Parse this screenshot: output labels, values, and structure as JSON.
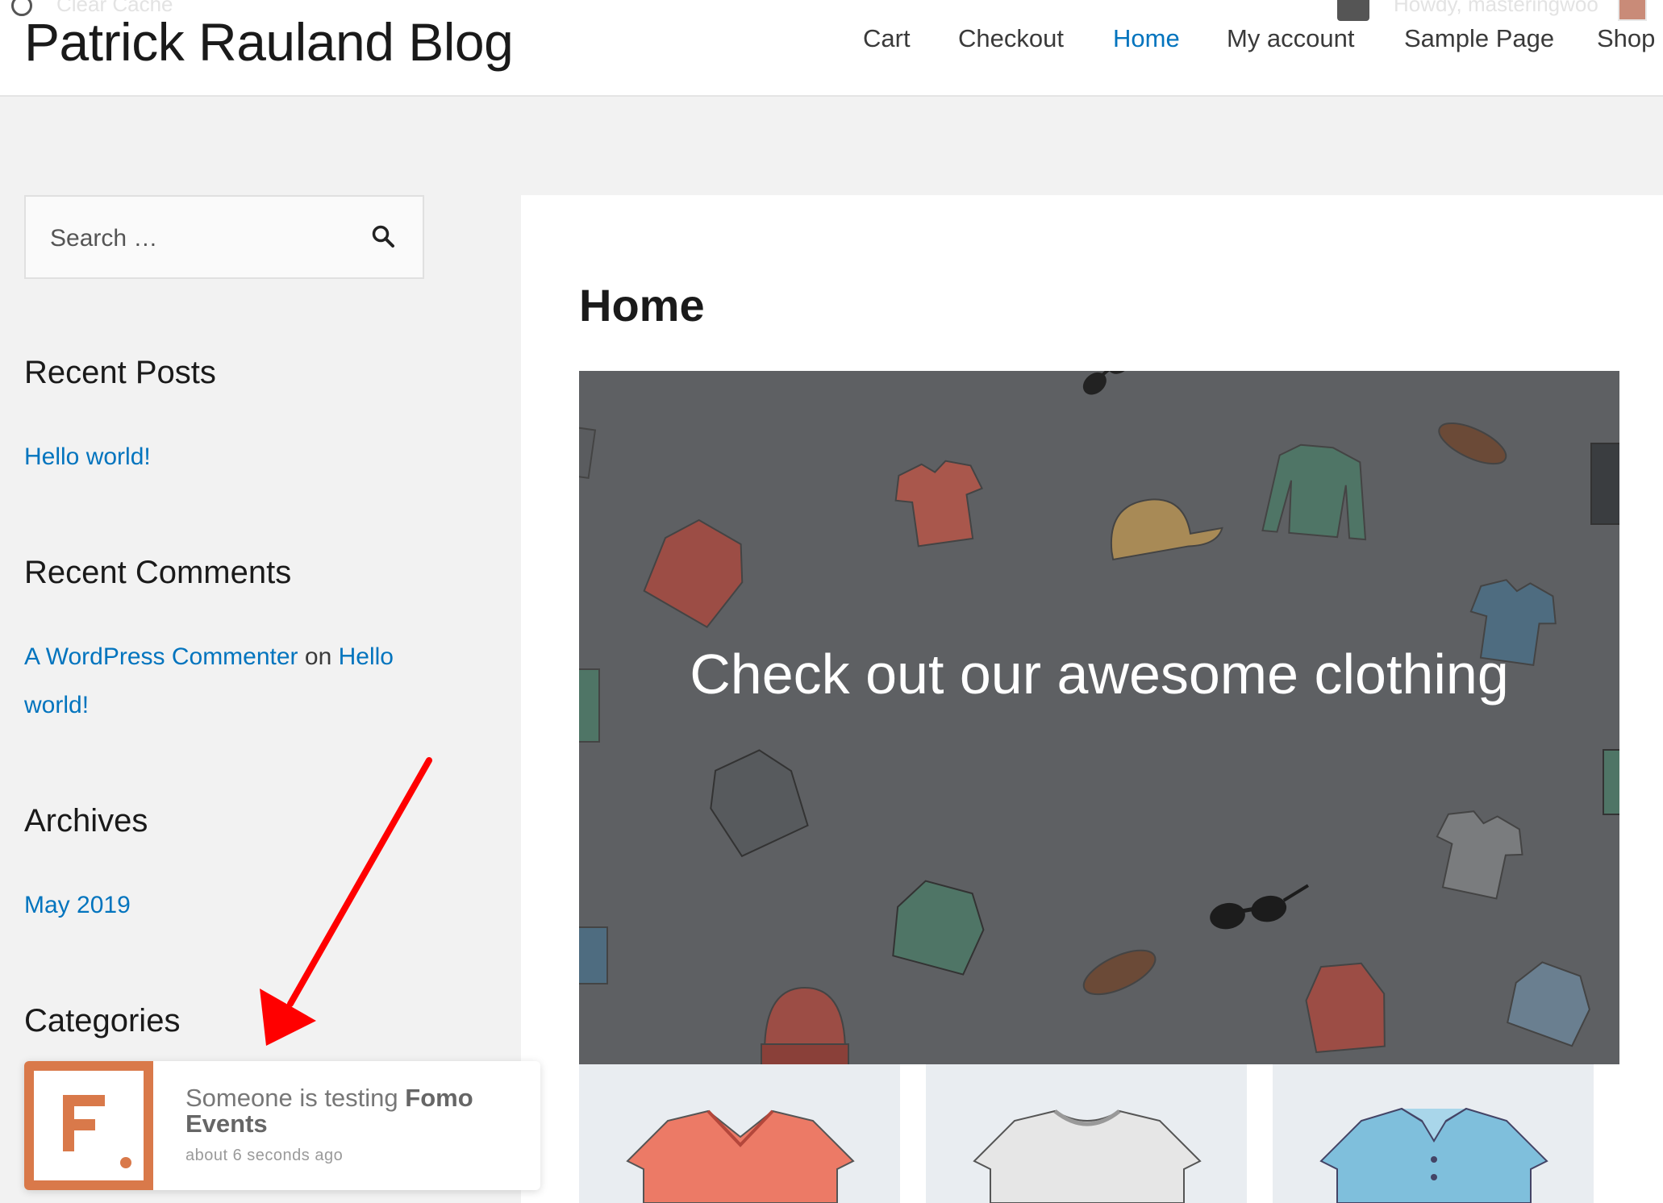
{
  "admin_bar": {
    "clear_cache": "Clear Cache",
    "howdy": "Howdy, masteringwoo"
  },
  "header": {
    "site_title": "Patrick Rauland Blog",
    "nav": [
      "Cart",
      "Checkout",
      "Home",
      "My account",
      "Sample Page",
      "Shop"
    ],
    "active_nav": "Home"
  },
  "sidebar": {
    "search": {
      "placeholder": "Search …"
    },
    "recent_posts": {
      "title": "Recent Posts",
      "items": [
        "Hello world!"
      ]
    },
    "recent_comments": {
      "title": "Recent Comments",
      "author": "A WordPress Commenter",
      "connector": "on",
      "post_part1": "Hello",
      "post_part2": "world!"
    },
    "archives": {
      "title": "Archives",
      "items": [
        "May 2019"
      ]
    },
    "categories": {
      "title": "Categories"
    }
  },
  "main": {
    "page_title": "Home",
    "hero_text": "Check out our awesome clothing",
    "products": [
      "tshirt-icon",
      "tshirt-icon",
      "polo-icon"
    ]
  },
  "notification": {
    "message_prefix": "Someone is testing",
    "message_bold": "Fomo Events",
    "time": "about 6 seconds ago",
    "logo_icon": "fomo-logo-icon"
  },
  "colors": {
    "link": "#0274be",
    "hero_bg": "#5e6063",
    "fomo_orange": "#d9794a",
    "arrow": "#ff0000"
  }
}
